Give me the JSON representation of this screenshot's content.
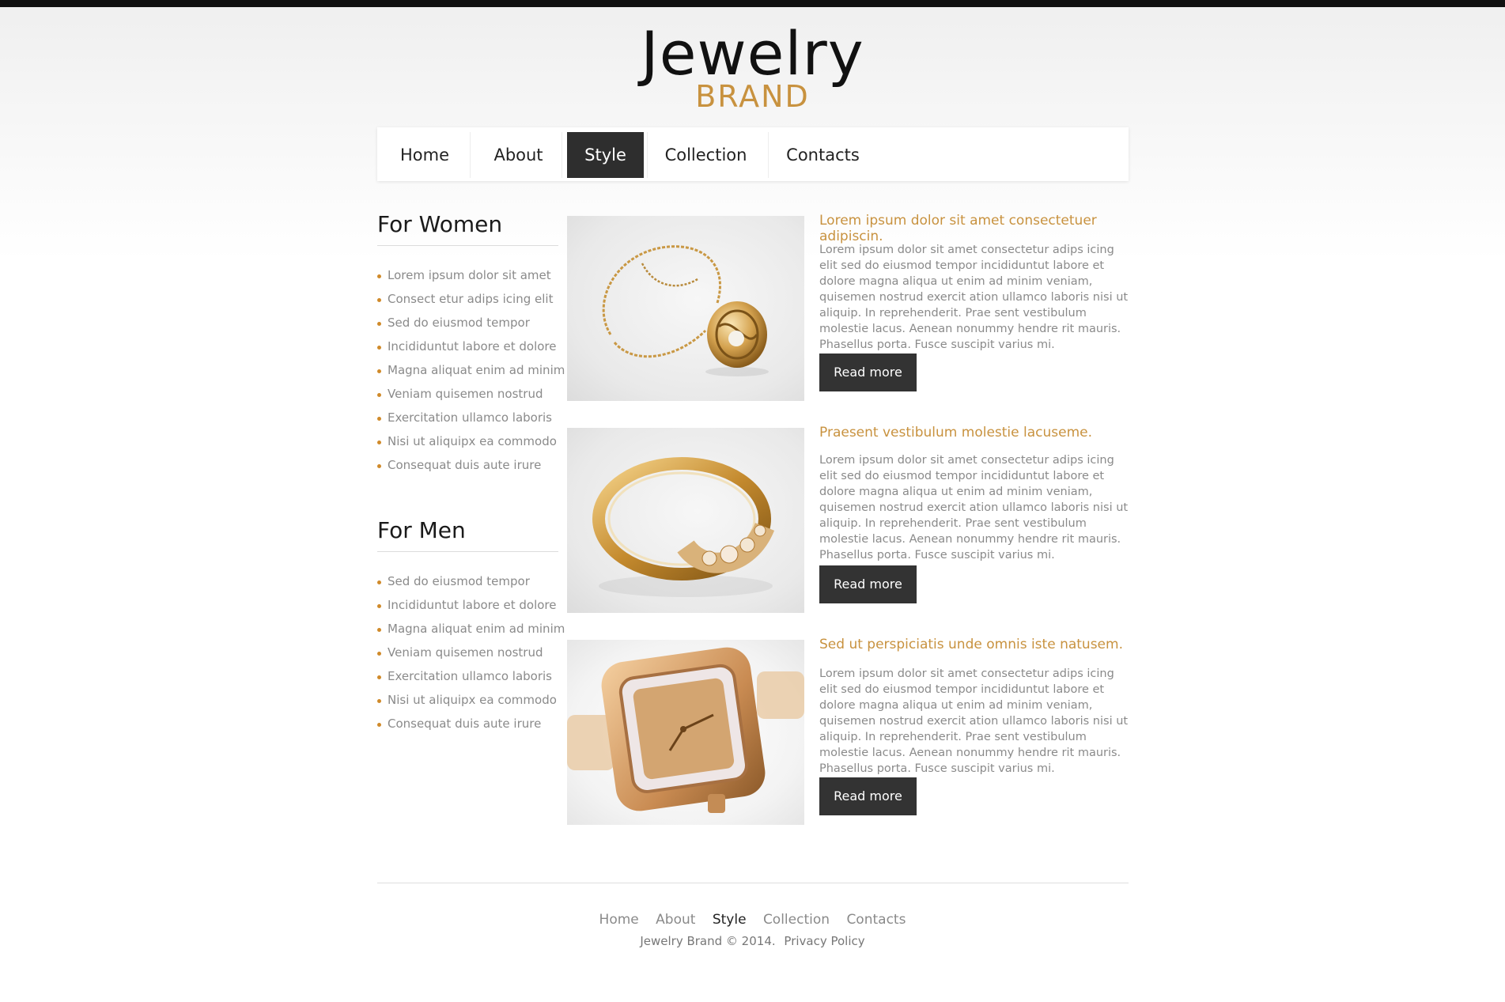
{
  "logo": {
    "line1": "Jewelry",
    "line2": "BRAND"
  },
  "nav": {
    "items": [
      {
        "label": "Home",
        "active": false
      },
      {
        "label": "About",
        "active": false
      },
      {
        "label": "Style",
        "active": true
      },
      {
        "label": "Collection",
        "active": false
      },
      {
        "label": "Contacts",
        "active": false
      }
    ]
  },
  "sidebar": {
    "women": {
      "title": "For Women",
      "items": [
        "Lorem ipsum dolor sit amet",
        "Consect etur adips icing elit",
        "Sed do eiusmod tempor",
        "Incididuntut labore et dolore",
        "Magna aliquat enim ad minim",
        "Veniam quisemen nostrud",
        "Exercitation ullamco laboris",
        "Nisi ut aliquipx ea commodo",
        "Consequat duis aute irure"
      ]
    },
    "men": {
      "title": "For Men",
      "items": [
        "Sed do eiusmod tempor",
        "Incididuntut labore et dolore",
        "Magna aliquat enim ad minim",
        "Veniam quisemen nostrud",
        "Exercitation ullamco laboris",
        "Nisi ut aliquipx ea commodo",
        "Consequat duis aute irure"
      ]
    }
  },
  "products": [
    {
      "image": "gold-necklace-image",
      "title": "Lorem ipsum dolor sit amet consectetuer adipiscin.",
      "text": "Lorem ipsum dolor sit amet consectetur adips icing elit sed do eiusmod tempor incididuntut labore et dolore magna aliqua ut enim ad minim veniam, quisemen nostrud exercit ation ullamco laboris nisi ut aliquip. In reprehenderit. Prae sent vestibulum molestie lacus. Aenean nonummy hendre rit mauris. Phasellus porta. Fusce suscipit varius mi.",
      "button": "Read more"
    },
    {
      "image": "gold-ring-image",
      "title": "Praesent vestibulum molestie lacuseme.",
      "text": "Lorem ipsum dolor sit amet consectetur adips icing elit sed do eiusmod tempor incididuntut labore et dolore magna aliqua ut enim ad minim veniam, quisemen nostrud exercit ation ullamco laboris nisi ut aliquip. In reprehenderit. Prae sent vestibulum molestie lacus. Aenean nonummy hendre rit mauris. Phasellus porta. Fusce suscipit varius mi.",
      "button": "Read more"
    },
    {
      "image": "gold-watch-image",
      "title": "Sed ut perspiciatis unde omnis iste natusem.",
      "text": "Lorem ipsum dolor sit amet consectetur adips icing elit sed do eiusmod tempor incididuntut labore et dolore magna aliqua ut enim ad minim veniam, quisemen nostrud exercit ation ullamco laboris nisi ut aliquip. In reprehenderit. Prae sent vestibulum molestie lacus. Aenean nonummy hendre rit mauris. Phasellus porta. Fusce suscipit varius mi.",
      "button": "Read more"
    }
  ],
  "footer": {
    "nav": [
      {
        "label": "Home",
        "active": false
      },
      {
        "label": "About",
        "active": false
      },
      {
        "label": "Style",
        "active": true
      },
      {
        "label": "Collection",
        "active": false
      },
      {
        "label": "Contacts",
        "active": false
      }
    ],
    "copyright": "Jewelry Brand © 2014.",
    "policy": "Privacy Policy"
  },
  "colors": {
    "accent": "#c8923f",
    "bullet": "#d08a2a",
    "dark": "#2e2e2e",
    "text": "#8a8a8a"
  }
}
